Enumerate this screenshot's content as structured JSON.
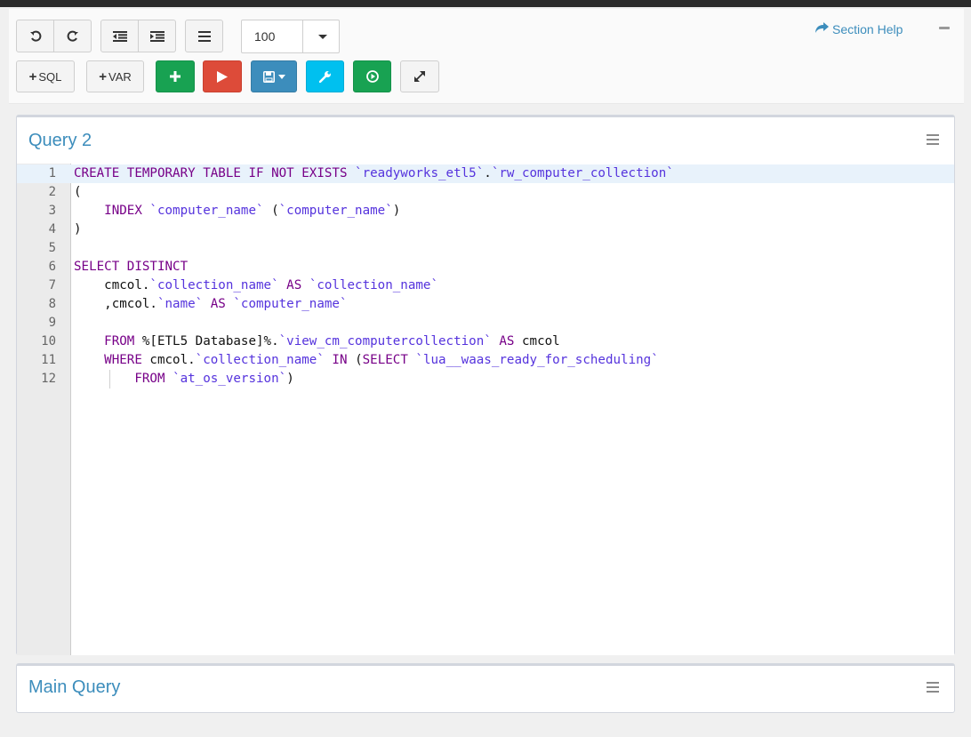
{
  "toolbar": {
    "undo_icon": "undo-icon",
    "redo_icon": "redo-icon",
    "outdent_icon": "outdent-icon",
    "indent_icon": "indent-icon",
    "menu_icon": "list-icon",
    "zoom_value": "100",
    "add_sql_label": "SQL",
    "add_var_label": "VAR",
    "buttons": [
      "plus-icon",
      "play-icon",
      "save-icon",
      "wrench-icon",
      "circle-play-icon",
      "expand-icon"
    ],
    "colors": {
      "green": "#18a252",
      "red": "#dd4b39",
      "blue": "#3c8dbc",
      "cyan": "#00c0ef"
    }
  },
  "section_help": {
    "label": "Section Help"
  },
  "panels": [
    {
      "title": "Query 2",
      "lines": [
        {
          "n": "1",
          "segments": [
            [
              "kw",
              "CREATE TEMPORARY TABLE IF NOT EXISTS "
            ],
            [
              "id",
              "`readyworks_etl5`"
            ],
            [
              "pl",
              "."
            ],
            [
              "id",
              "`rw_computer_collection`"
            ]
          ]
        },
        {
          "n": "2",
          "segments": [
            [
              "pl",
              "("
            ]
          ]
        },
        {
          "n": "3",
          "segments": [
            [
              "pl",
              "    "
            ],
            [
              "kw",
              "INDEX "
            ],
            [
              "id",
              "`computer_name`"
            ],
            [
              "pl",
              " ("
            ],
            [
              "id",
              "`computer_name`"
            ],
            [
              "pl",
              ")"
            ]
          ]
        },
        {
          "n": "4",
          "segments": [
            [
              "pl",
              ")"
            ]
          ]
        },
        {
          "n": "5",
          "segments": []
        },
        {
          "n": "6",
          "segments": [
            [
              "kw",
              "SELECT DISTINCT"
            ]
          ]
        },
        {
          "n": "7",
          "segments": [
            [
              "pl",
              "    cmcol."
            ],
            [
              "id",
              "`collection_name`"
            ],
            [
              "kw",
              " AS "
            ],
            [
              "id",
              "`collection_name`"
            ]
          ]
        },
        {
          "n": "8",
          "segments": [
            [
              "pl",
              "    ,cmcol."
            ],
            [
              "id",
              "`name`"
            ],
            [
              "kw",
              " AS "
            ],
            [
              "id",
              "`computer_name`"
            ]
          ]
        },
        {
          "n": "9",
          "segments": []
        },
        {
          "n": "10",
          "segments": [
            [
              "pl",
              "    "
            ],
            [
              "kw",
              "FROM "
            ],
            [
              "pl",
              "%[ETL5 Database]%."
            ],
            [
              "id",
              "`view_cm_computercollection`"
            ],
            [
              "kw",
              " AS "
            ],
            [
              "pl",
              "cmcol"
            ]
          ]
        },
        {
          "n": "11",
          "segments": [
            [
              "pl",
              "    "
            ],
            [
              "kw",
              "WHERE "
            ],
            [
              "pl",
              "cmcol."
            ],
            [
              "id",
              "`collection_name`"
            ],
            [
              "kw",
              " IN "
            ],
            [
              "pl",
              "("
            ],
            [
              "kw",
              "SELECT "
            ],
            [
              "id",
              "`lua__waas_ready_for_scheduling`"
            ]
          ]
        },
        {
          "n": "12",
          "segments": [
            [
              "pl",
              "        "
            ],
            [
              "kw",
              "FROM "
            ],
            [
              "id",
              "`at_os_version`"
            ],
            [
              "pl",
              ")"
            ]
          ]
        }
      ]
    },
    {
      "title": "Main Query"
    }
  ]
}
